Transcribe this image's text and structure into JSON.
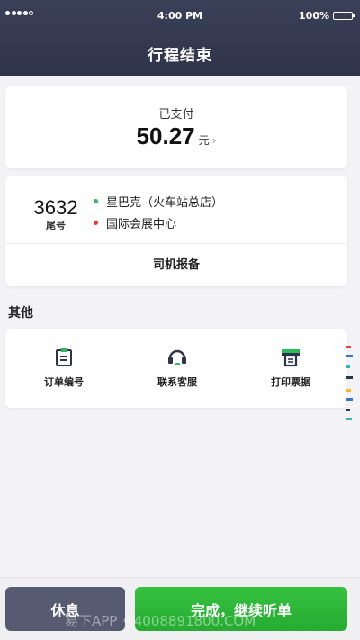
{
  "status_bar": {
    "time": "4:00 PM",
    "battery": "100%"
  },
  "header": {
    "title": "行程结束"
  },
  "payment": {
    "status": "已支付",
    "amount": "50.27",
    "currency": "元"
  },
  "trip": {
    "tail_number": "3632",
    "tail_label": "尾号",
    "start": "星巴克（火车站总店）",
    "end": "国际会展中心",
    "report_label": "司机报备"
  },
  "other": {
    "title": "其他",
    "items": [
      {
        "label": "订单编号",
        "icon": "order-number-icon"
      },
      {
        "label": "联系客服",
        "icon": "headset-icon"
      },
      {
        "label": "打印票据",
        "icon": "printer-icon"
      }
    ]
  },
  "footer": {
    "rest_label": "休息",
    "done_label": "完成，继续听单"
  },
  "watermark": "易下APP • 4008891800.COM",
  "colors": {
    "header": "#2f344a",
    "accent_green": "#2bbd5c",
    "accent_red": "#e53a3a",
    "rest_button": "#565b72",
    "done_button": "#2fb83a"
  }
}
